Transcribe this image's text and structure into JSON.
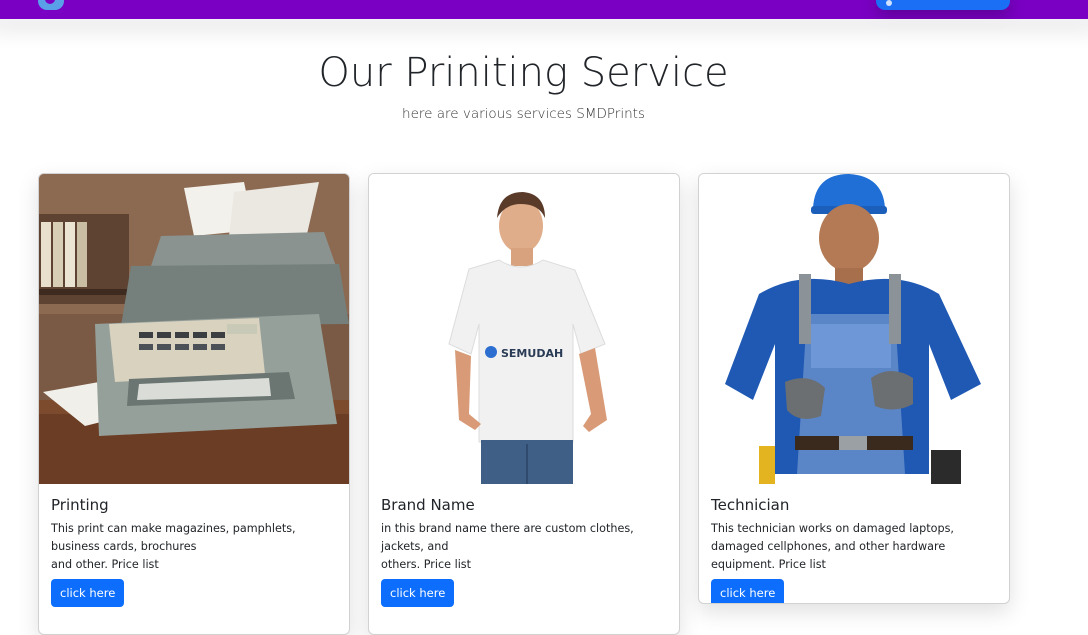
{
  "header": {
    "title": "Our Priniting Service",
    "subtitle": "here are various services SMDPrints"
  },
  "cards": [
    {
      "title": "Printing",
      "text_lines": [
        "This print can make magazines, pamphlets, business cards, brochures",
        "and other. Price list"
      ],
      "button_label": "click here",
      "image": "printer-photo"
    },
    {
      "title": "Brand Name",
      "text_lines": [
        "in this brand name there are custom clothes, jackets, and",
        "others. Price list"
      ],
      "button_label": "click here",
      "image": "tshirt-model-photo",
      "shirt_logo_text": "SEMUDAH"
    },
    {
      "title": "Technician",
      "text_lines": [
        "This technician works on damaged laptops, damaged cellphones, and other hardware equipment. Price list"
      ],
      "button_label": "click here",
      "image": "technician-photo"
    }
  ],
  "colors": {
    "navbar": "#7a00c4",
    "button": "#0d6efd"
  }
}
